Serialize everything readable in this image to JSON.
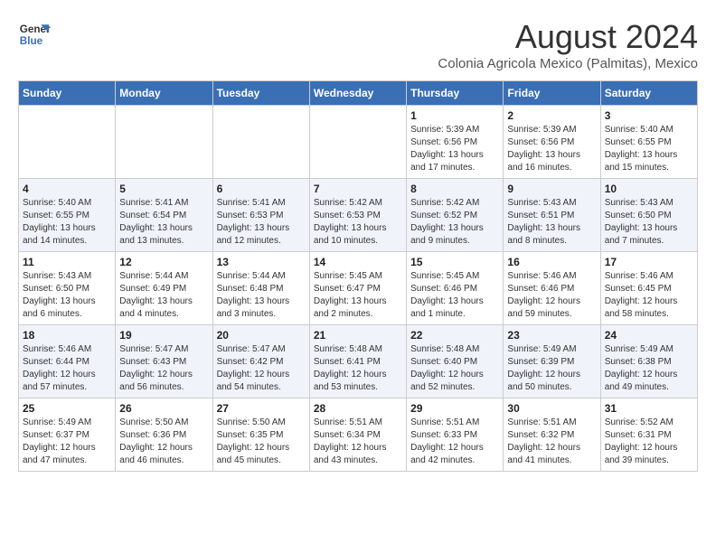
{
  "header": {
    "logo_line1": "General",
    "logo_line2": "Blue",
    "month_year": "August 2024",
    "location": "Colonia Agricola Mexico (Palmitas), Mexico"
  },
  "days_of_week": [
    "Sunday",
    "Monday",
    "Tuesday",
    "Wednesday",
    "Thursday",
    "Friday",
    "Saturday"
  ],
  "weeks": [
    [
      {
        "day": "",
        "info": ""
      },
      {
        "day": "",
        "info": ""
      },
      {
        "day": "",
        "info": ""
      },
      {
        "day": "",
        "info": ""
      },
      {
        "day": "1",
        "info": "Sunrise: 5:39 AM\nSunset: 6:56 PM\nDaylight: 13 hours\nand 17 minutes."
      },
      {
        "day": "2",
        "info": "Sunrise: 5:39 AM\nSunset: 6:56 PM\nDaylight: 13 hours\nand 16 minutes."
      },
      {
        "day": "3",
        "info": "Sunrise: 5:40 AM\nSunset: 6:55 PM\nDaylight: 13 hours\nand 15 minutes."
      }
    ],
    [
      {
        "day": "4",
        "info": "Sunrise: 5:40 AM\nSunset: 6:55 PM\nDaylight: 13 hours\nand 14 minutes."
      },
      {
        "day": "5",
        "info": "Sunrise: 5:41 AM\nSunset: 6:54 PM\nDaylight: 13 hours\nand 13 minutes."
      },
      {
        "day": "6",
        "info": "Sunrise: 5:41 AM\nSunset: 6:53 PM\nDaylight: 13 hours\nand 12 minutes."
      },
      {
        "day": "7",
        "info": "Sunrise: 5:42 AM\nSunset: 6:53 PM\nDaylight: 13 hours\nand 10 minutes."
      },
      {
        "day": "8",
        "info": "Sunrise: 5:42 AM\nSunset: 6:52 PM\nDaylight: 13 hours\nand 9 minutes."
      },
      {
        "day": "9",
        "info": "Sunrise: 5:43 AM\nSunset: 6:51 PM\nDaylight: 13 hours\nand 8 minutes."
      },
      {
        "day": "10",
        "info": "Sunrise: 5:43 AM\nSunset: 6:50 PM\nDaylight: 13 hours\nand 7 minutes."
      }
    ],
    [
      {
        "day": "11",
        "info": "Sunrise: 5:43 AM\nSunset: 6:50 PM\nDaylight: 13 hours\nand 6 minutes."
      },
      {
        "day": "12",
        "info": "Sunrise: 5:44 AM\nSunset: 6:49 PM\nDaylight: 13 hours\nand 4 minutes."
      },
      {
        "day": "13",
        "info": "Sunrise: 5:44 AM\nSunset: 6:48 PM\nDaylight: 13 hours\nand 3 minutes."
      },
      {
        "day": "14",
        "info": "Sunrise: 5:45 AM\nSunset: 6:47 PM\nDaylight: 13 hours\nand 2 minutes."
      },
      {
        "day": "15",
        "info": "Sunrise: 5:45 AM\nSunset: 6:46 PM\nDaylight: 13 hours\nand 1 minute."
      },
      {
        "day": "16",
        "info": "Sunrise: 5:46 AM\nSunset: 6:46 PM\nDaylight: 12 hours\nand 59 minutes."
      },
      {
        "day": "17",
        "info": "Sunrise: 5:46 AM\nSunset: 6:45 PM\nDaylight: 12 hours\nand 58 minutes."
      }
    ],
    [
      {
        "day": "18",
        "info": "Sunrise: 5:46 AM\nSunset: 6:44 PM\nDaylight: 12 hours\nand 57 minutes."
      },
      {
        "day": "19",
        "info": "Sunrise: 5:47 AM\nSunset: 6:43 PM\nDaylight: 12 hours\nand 56 minutes."
      },
      {
        "day": "20",
        "info": "Sunrise: 5:47 AM\nSunset: 6:42 PM\nDaylight: 12 hours\nand 54 minutes."
      },
      {
        "day": "21",
        "info": "Sunrise: 5:48 AM\nSunset: 6:41 PM\nDaylight: 12 hours\nand 53 minutes."
      },
      {
        "day": "22",
        "info": "Sunrise: 5:48 AM\nSunset: 6:40 PM\nDaylight: 12 hours\nand 52 minutes."
      },
      {
        "day": "23",
        "info": "Sunrise: 5:49 AM\nSunset: 6:39 PM\nDaylight: 12 hours\nand 50 minutes."
      },
      {
        "day": "24",
        "info": "Sunrise: 5:49 AM\nSunset: 6:38 PM\nDaylight: 12 hours\nand 49 minutes."
      }
    ],
    [
      {
        "day": "25",
        "info": "Sunrise: 5:49 AM\nSunset: 6:37 PM\nDaylight: 12 hours\nand 47 minutes."
      },
      {
        "day": "26",
        "info": "Sunrise: 5:50 AM\nSunset: 6:36 PM\nDaylight: 12 hours\nand 46 minutes."
      },
      {
        "day": "27",
        "info": "Sunrise: 5:50 AM\nSunset: 6:35 PM\nDaylight: 12 hours\nand 45 minutes."
      },
      {
        "day": "28",
        "info": "Sunrise: 5:51 AM\nSunset: 6:34 PM\nDaylight: 12 hours\nand 43 minutes."
      },
      {
        "day": "29",
        "info": "Sunrise: 5:51 AM\nSunset: 6:33 PM\nDaylight: 12 hours\nand 42 minutes."
      },
      {
        "day": "30",
        "info": "Sunrise: 5:51 AM\nSunset: 6:32 PM\nDaylight: 12 hours\nand 41 minutes."
      },
      {
        "day": "31",
        "info": "Sunrise: 5:52 AM\nSunset: 6:31 PM\nDaylight: 12 hours\nand 39 minutes."
      }
    ]
  ]
}
